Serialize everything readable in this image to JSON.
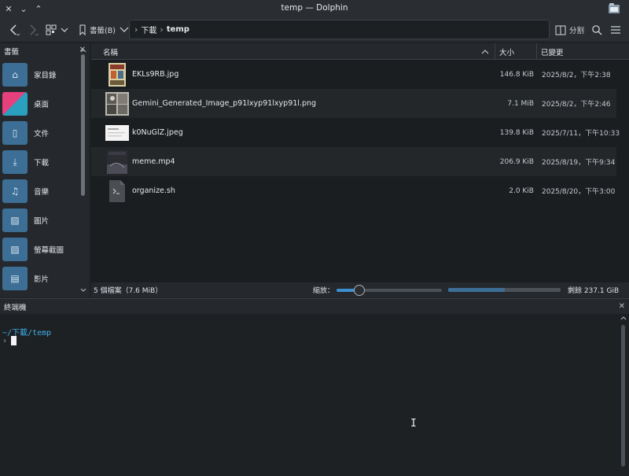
{
  "window": {
    "title": "temp — Dolphin"
  },
  "toolbar": {
    "bookmarks_label": "書籤(B)",
    "split_label": "分割",
    "path": [
      "下載",
      "temp"
    ]
  },
  "sidebar": {
    "header": "書籤",
    "items": [
      {
        "label": "家目錄",
        "icon": "home-folder-icon"
      },
      {
        "label": "桌面",
        "icon": "desktop-icon"
      },
      {
        "label": "文件",
        "icon": "documents-folder-icon"
      },
      {
        "label": "下載",
        "icon": "downloads-folder-icon"
      },
      {
        "label": "音樂",
        "icon": "music-folder-icon"
      },
      {
        "label": "圖片",
        "icon": "pictures-folder-icon"
      },
      {
        "label": "螢幕截圖",
        "icon": "screenshots-folder-icon"
      },
      {
        "label": "影片",
        "icon": "videos-folder-icon"
      }
    ]
  },
  "columns": {
    "name": "名稱",
    "size": "大小",
    "modified": "已變更"
  },
  "files": [
    {
      "name": "EKLs9RB.jpg",
      "size": "146.8 KiB",
      "modified": "2025/8/2，下午2:38",
      "thumb": "image-thumb"
    },
    {
      "name": "Gemini_Generated_Image_p91lxyp91lxyp91l.png",
      "size": "7.1 MiB",
      "modified": "2025/8/2，下午2:46",
      "thumb": "image-thumb"
    },
    {
      "name": "k0NuGlZ.jpeg",
      "size": "139.8 KiB",
      "modified": "2025/7/11，下午10:33",
      "thumb": "image-thumb"
    },
    {
      "name": "meme.mp4",
      "size": "206.9 KiB",
      "modified": "2025/8/19，下午9:34",
      "thumb": "video-thumb"
    },
    {
      "name": "organize.sh",
      "size": "2.0 KiB",
      "modified": "2025/8/20，下午3:00",
      "thumb": "script-file-icon"
    }
  ],
  "status": {
    "summary": "5 個檔案（7.6 MiB）",
    "zoom_label": "縮放：",
    "free_space": "剩餘 237.1 GiB",
    "zoom_level": 0.22,
    "space_used": 0.5
  },
  "terminal": {
    "header": "終端機",
    "cwd_prefix": "~/",
    "cwd_dir": "下載",
    "cwd_rest": "/temp",
    "prompt": "›"
  },
  "colors": {
    "accent": "#3daee9",
    "folder": "#3d6f96"
  }
}
